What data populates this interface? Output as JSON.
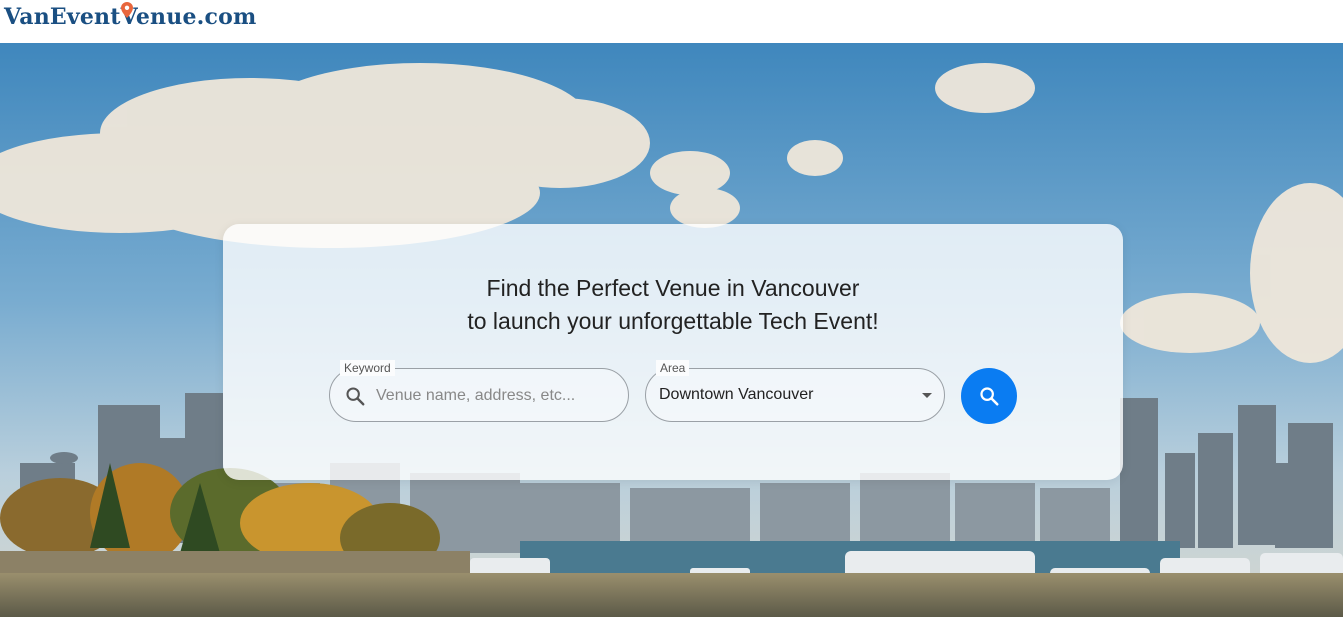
{
  "brand": {
    "logo_text": "VanEventVenue.com"
  },
  "hero": {
    "headline_line1": "Find the Perfect Venue in Vancouver",
    "headline_line2": "to launch your unforgettable Tech Event!"
  },
  "search": {
    "keyword_label": "Keyword",
    "keyword_placeholder": "Venue name, address, etc...",
    "keyword_value": "",
    "area_label": "Area",
    "area_value": "Downtown Vancouver",
    "submit_icon": "search-icon"
  },
  "colors": {
    "brand_text": "#1a4f82",
    "pin": "#e8663d",
    "search_button": "#0a7cf2"
  }
}
